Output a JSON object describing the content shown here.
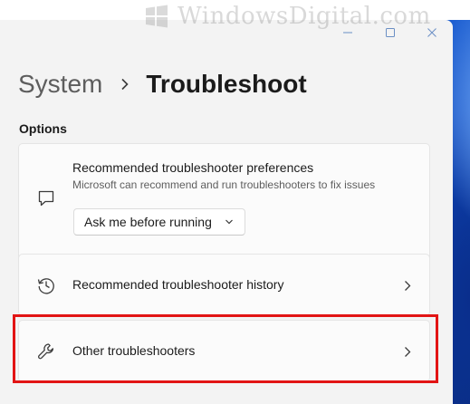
{
  "watermark": {
    "text": "WindowsDigital.com"
  },
  "window_controls": {
    "minimize_icon": "minimize-icon",
    "maximize_icon": "maximize-icon",
    "close_icon": "close-icon"
  },
  "breadcrumb": {
    "parent": "System",
    "current": "Troubleshoot"
  },
  "options": {
    "section_label": "Options",
    "preferences": {
      "title": "Recommended troubleshooter preferences",
      "description": "Microsoft can recommend and run troubleshooters to fix issues",
      "icon": "chat-bubble-icon",
      "dropdown_value": "Ask me before running"
    },
    "history": {
      "label": "Recommended troubleshooter history",
      "icon": "history-icon"
    },
    "other": {
      "label": "Other troubleshooters",
      "icon": "wrench-icon"
    }
  },
  "colors": {
    "highlight": "#e21414",
    "window_bg": "#f3f3f3",
    "card_bg": "#fbfbfb"
  }
}
